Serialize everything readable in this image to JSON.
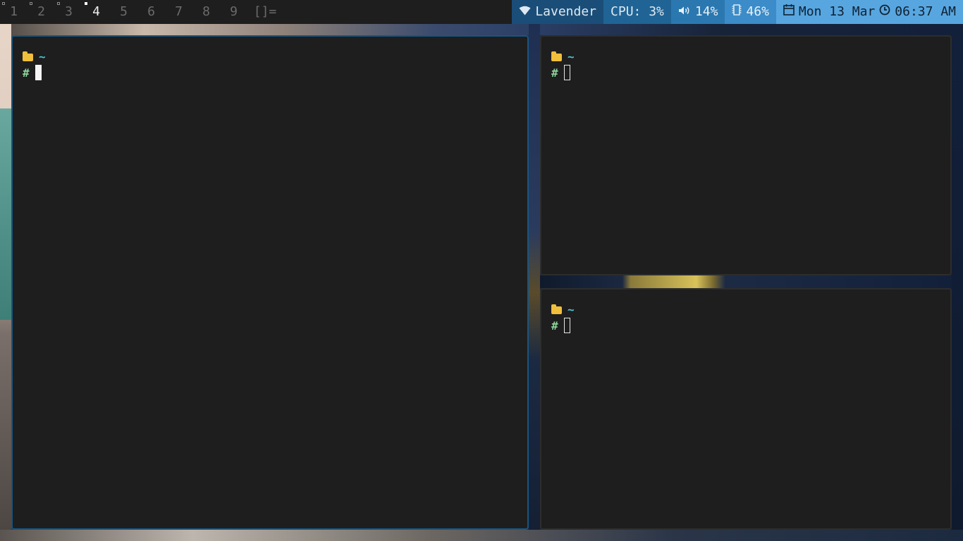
{
  "bar": {
    "tags": [
      "1",
      "2",
      "3",
      "4",
      "5",
      "6",
      "7",
      "8",
      "9"
    ],
    "active_tag": "4",
    "layout_symbol": "[]=",
    "wifi": {
      "icon": "wifi-icon",
      "label": "Lavender",
      "color": "#1a4e78"
    },
    "cpu": {
      "label": "CPU: 3%",
      "color": "#1f6495"
    },
    "volume": {
      "icon": "speaker-icon",
      "label": "14%",
      "color": "#2b78b0"
    },
    "memory": {
      "icon": "memory-chip-icon",
      "label": "46%",
      "color": "#3b8cc8"
    },
    "date": {
      "icon": "calendar-icon",
      "label": "Mon 13 Mar",
      "color": "#58a6e0"
    },
    "time": {
      "icon": "clock-icon",
      "label": "06:37 AM"
    }
  },
  "terminals": [
    {
      "cwd": "~",
      "prompt": "#",
      "focused": true
    },
    {
      "cwd": "~",
      "prompt": "#",
      "focused": false
    },
    {
      "cwd": "~",
      "prompt": "#",
      "focused": false
    }
  ],
  "colors": {
    "focus_border": "#19557f",
    "terminal_bg": "#1e1e1e",
    "cwd": "#4ec3d6",
    "prompt": "#8bd39a",
    "folder": "#f0bf3c"
  }
}
